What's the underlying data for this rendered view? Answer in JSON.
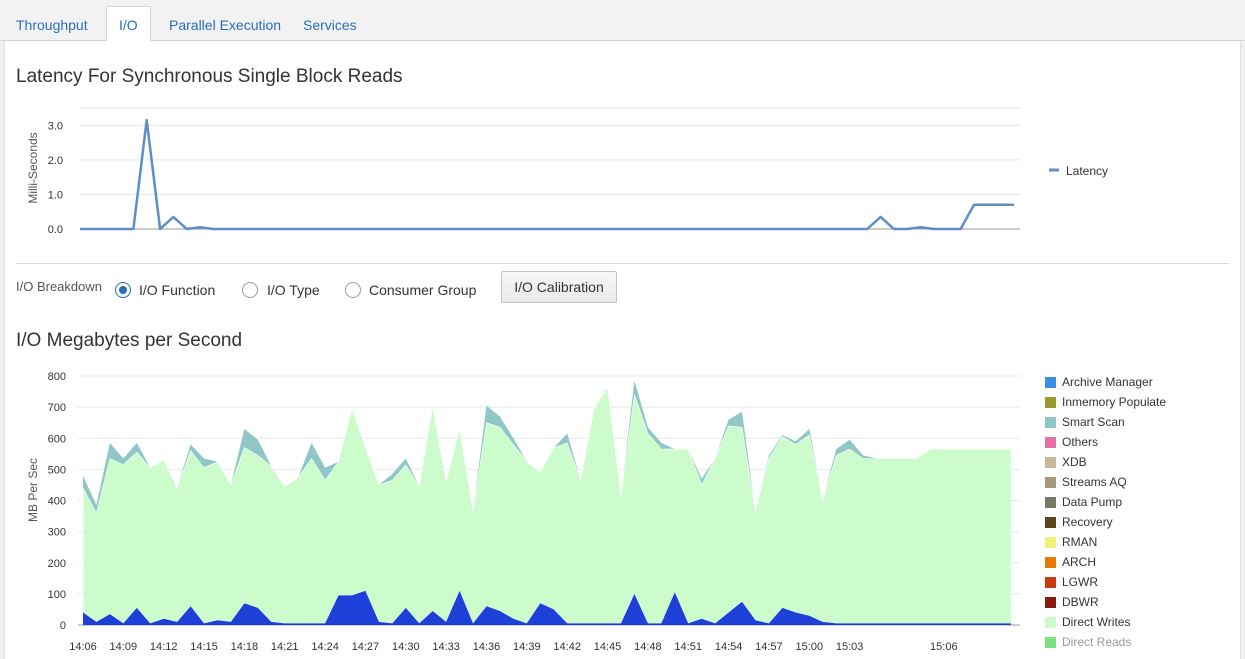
{
  "tabs": [
    {
      "label": "Throughput",
      "active": false
    },
    {
      "label": "I/O",
      "active": true
    },
    {
      "label": "Parallel Execution",
      "active": false
    },
    {
      "label": "Services",
      "active": false
    }
  ],
  "latency_section": {
    "title": "Latency For Synchronous Single Block Reads"
  },
  "breakdown": {
    "label": "I/O Breakdown",
    "options": [
      {
        "label": "I/O Function",
        "checked": true
      },
      {
        "label": "I/O Type",
        "checked": false
      },
      {
        "label": "Consumer Group",
        "checked": false
      }
    ],
    "calibration_button": "I/O Calibration"
  },
  "mb_section": {
    "title": "I/O Megabytes per Second"
  },
  "chart_data": [
    {
      "type": "line",
      "ylabel": "Milli-Seconds",
      "ylim": [
        0,
        3.0
      ],
      "yticks": [
        "0.0",
        "1.0",
        "2.0",
        "3.0"
      ],
      "grid": true,
      "legend_position": "right",
      "series": [
        {
          "name": "Latency",
          "color": "#5b8fc6",
          "values": [
            0.0,
            0.0,
            0.0,
            0.0,
            0.0,
            3.15,
            0.0,
            0.35,
            0.0,
            0.05,
            0.0,
            0.0,
            0.0,
            0.0,
            0.0,
            0.0,
            0.0,
            0.0,
            0.0,
            0.0,
            0.0,
            0.0,
            0.0,
            0.0,
            0.0,
            0.0,
            0.0,
            0.0,
            0.0,
            0.0,
            0.0,
            0.0,
            0.0,
            0.0,
            0.0,
            0.0,
            0.0,
            0.0,
            0.0,
            0.0,
            0.0,
            0.0,
            0.0,
            0.0,
            0.0,
            0.0,
            0.0,
            0.0,
            0.0,
            0.0,
            0.0,
            0.0,
            0.0,
            0.0,
            0.0,
            0.0,
            0.0,
            0.0,
            0.0,
            0.0,
            0.35,
            0.0,
            0.0,
            0.05,
            0.0,
            0.0,
            0.0,
            0.7,
            0.7,
            0.7,
            0.7
          ]
        }
      ]
    },
    {
      "type": "area",
      "ylabel": "MB Per Sec",
      "ylim": [
        0,
        800
      ],
      "yticks": [
        "0",
        "100",
        "200",
        "300",
        "400",
        "500",
        "600",
        "700",
        "800"
      ],
      "xticks": [
        "14:06",
        "14:09",
        "14:12",
        "14:15",
        "14:18",
        "14:21",
        "14:24",
        "14:27",
        "14:30",
        "14:33",
        "14:36",
        "14:39",
        "14:42",
        "14:45",
        "14:48",
        "14:51",
        "14:54",
        "14:57",
        "15:00",
        "15:03",
        "15:06"
      ],
      "grid": true,
      "legend_position": "right",
      "x_count": 70,
      "series": [
        {
          "name": "Archive Manager",
          "color": "#3b8ee8",
          "values": []
        },
        {
          "name": "Inmemory Populate",
          "color": "#9a9a2a",
          "values": []
        },
        {
          "name": "Smart Scan",
          "color": "#8fc6c6",
          "values": []
        },
        {
          "name": "Others",
          "color": "#e86ea8",
          "values": []
        },
        {
          "name": "XDB",
          "color": "#c8b89a",
          "values": []
        },
        {
          "name": "Streams AQ",
          "color": "#a8987a",
          "values": []
        },
        {
          "name": "Data Pump",
          "color": "#7a7a62",
          "values": []
        },
        {
          "name": "Recovery",
          "color": "#5a4418",
          "values": []
        },
        {
          "name": "RMAN",
          "color": "#f2f07a",
          "values": []
        },
        {
          "name": "ARCH",
          "color": "#e8780a",
          "values": []
        },
        {
          "name": "LGWR",
          "color": "#c83a10",
          "values": []
        },
        {
          "name": "DBWR",
          "color": "#8a1a10",
          "values": []
        },
        {
          "name": "Direct Writes",
          "color": "#ccfccc",
          "values": [
            400,
            350,
            500,
            510,
            500,
            500,
            510,
            430,
            500,
            500,
            510,
            440,
            500,
            490,
            500,
            440,
            470,
            530,
            460,
            430,
            600,
            460,
            440,
            460,
            460,
            440,
            660,
            450,
            520,
            360,
            590,
            590,
            560,
            520,
            420,
            520,
            580,
            460,
            690,
            760,
            410,
            640,
            610,
            560,
            460,
            560,
            430,
            530,
            600,
            560,
            350,
            530,
            550,
            540,
            580,
            390,
            540,
            560,
            530,
            530,
            530,
            530,
            530,
            560,
            560,
            560,
            560,
            560,
            560,
            560
          ]
        },
        {
          "name": "Direct Reads",
          "color": "#7fe07f",
          "values": [
            40,
            10,
            35,
            5,
            55,
            5,
            20,
            10,
            60,
            5,
            15,
            10,
            70,
            55,
            10,
            5,
            5,
            5,
            5,
            95,
            95,
            110,
            10,
            5,
            55,
            5,
            45,
            10,
            110,
            5,
            60,
            45,
            20,
            5,
            70,
            50,
            5,
            5,
            5,
            5,
            5,
            100,
            5,
            5,
            105,
            5,
            20,
            5,
            40,
            75,
            15,
            5,
            55,
            40,
            30,
            10,
            5,
            5,
            5,
            5,
            5,
            5,
            5,
            5,
            5,
            5,
            5,
            5,
            5,
            5
          ]
        }
      ],
      "top_series_smart_scan": [
        40,
        25,
        50,
        20,
        30,
        0,
        0,
        0,
        20,
        30,
        0,
        0,
        60,
        50,
        0,
        0,
        0,
        50,
        40,
        0,
        0,
        0,
        0,
        20,
        20,
        0,
        0,
        0,
        0,
        0,
        55,
        35,
        20,
        0,
        0,
        0,
        30,
        0,
        0,
        0,
        0,
        45,
        20,
        20,
        0,
        0,
        20,
        0,
        20,
        50,
        0,
        10,
        5,
        10,
        20,
        0,
        20,
        30,
        10,
        0,
        0,
        0,
        0,
        0,
        0,
        0,
        0,
        0,
        0,
        0
      ]
    }
  ]
}
